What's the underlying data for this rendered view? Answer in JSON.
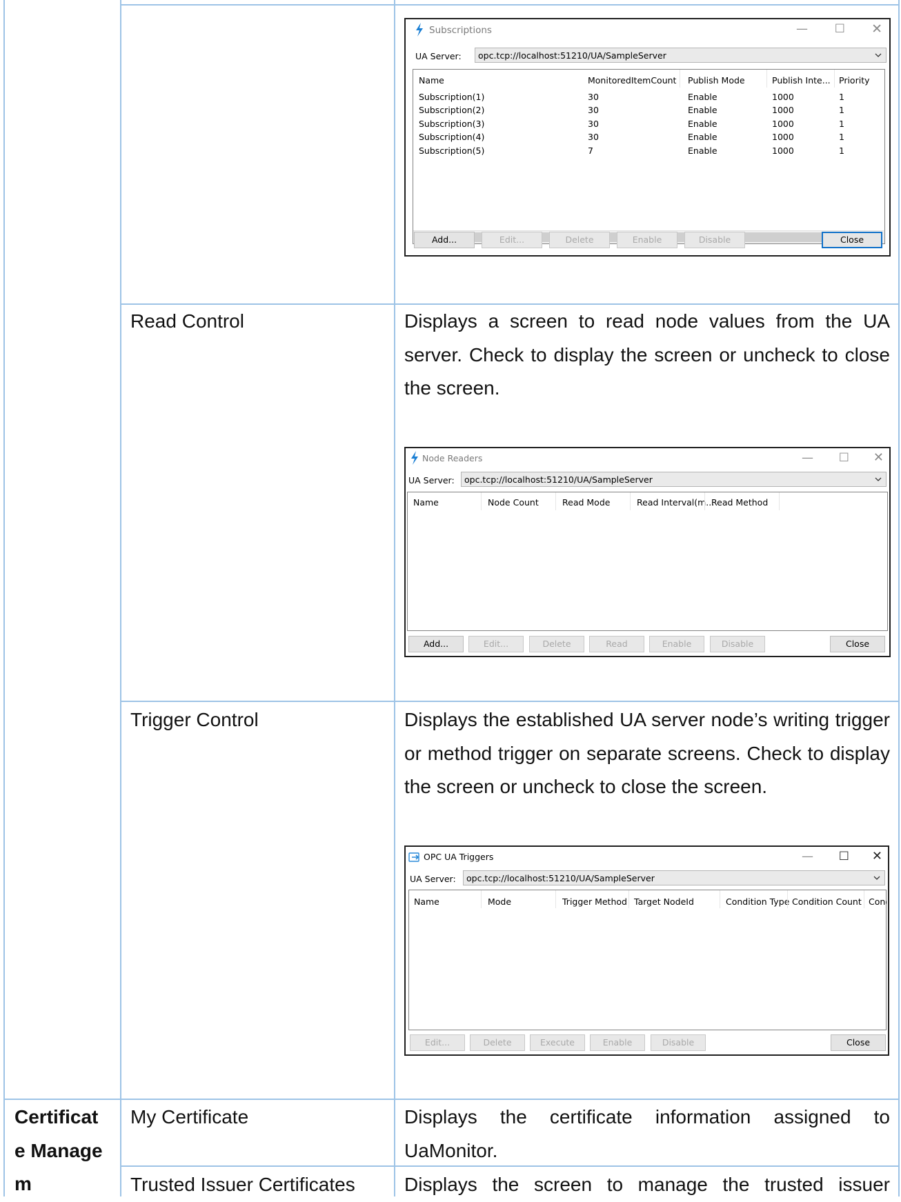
{
  "rows": {
    "read_control": {
      "feature": "Read Control",
      "description": "Displays a screen to read node values from the UA server. Check to display the screen or uncheck to close the screen."
    },
    "trigger_control": {
      "feature": "Trigger Control",
      "description": "Displays the established UA server node’s writing trigger or method trigger on separate screens. Check to display the screen or uncheck to close the screen."
    },
    "category_certificate": "Certificat e Managem",
    "my_certificate": {
      "feature": "My Certificate",
      "description": "Displays the certificate information assigned to UaMonitor."
    },
    "trusted_issuer": {
      "feature": "Trusted Issuer Certificates",
      "description": "Displays the screen to manage the trusted issuer"
    }
  },
  "subscriptions_window": {
    "title": "Subscriptions",
    "server_label": "UA Server:",
    "server_value": "opc.tcp://localhost:51210/UA/SampleServer",
    "columns": [
      "Name",
      "MonitoredItemCount",
      "Publish Mode",
      "Publish Inte...",
      "Priority"
    ],
    "rows": [
      [
        "Subscription(1)",
        "30",
        "Enable",
        "1000",
        "1"
      ],
      [
        "Subscription(2)",
        "30",
        "Enable",
        "1000",
        "1"
      ],
      [
        "Subscription(3)",
        "30",
        "Enable",
        "1000",
        "1"
      ],
      [
        "Subscription(4)",
        "30",
        "Enable",
        "1000",
        "1"
      ],
      [
        "Subscription(5)",
        "7",
        "Enable",
        "1000",
        "1"
      ]
    ],
    "buttons": {
      "add": "Add...",
      "edit": "Edit...",
      "delete": "Delete",
      "enable": "Enable",
      "disable": "Disable",
      "close": "Close"
    }
  },
  "node_readers_window": {
    "title": "Node Readers",
    "server_label": "UA Server:",
    "server_value": "opc.tcp://localhost:51210/UA/SampleServer",
    "columns": [
      "Name",
      "Node Count",
      "Read Mode",
      "Read Interval(m...",
      "Read Method"
    ],
    "buttons": {
      "add": "Add...",
      "edit": "Edit...",
      "delete": "Delete",
      "read": "Read",
      "enable": "Enable",
      "disable": "Disable",
      "close": "Close"
    }
  },
  "triggers_window": {
    "title": "OPC UA Triggers",
    "server_label": "UA Server:",
    "server_value": "opc.tcp://localhost:51210/UA/SampleServer",
    "columns": [
      "Name",
      "Mode",
      "Trigger Method",
      "Target NodeId",
      "Condition Type",
      "Condition Count",
      "Conc"
    ],
    "buttons": {
      "edit": "Edit...",
      "delete": "Delete",
      "execute": "Execute",
      "enable": "Enable",
      "disable": "Disable",
      "close": "Close"
    }
  },
  "icons": {
    "bolt": "lightning-bolt-icon",
    "trigger": "trigger-arrow-icon",
    "minimize": "minimize-icon",
    "maximize": "maximize-icon",
    "close": "close-icon",
    "chevron": "chevron-down-icon"
  },
  "colors": {
    "table_border": "#9dc3e6",
    "default_button_border": "#0f70c9",
    "bolt": "#1a7fd4"
  }
}
